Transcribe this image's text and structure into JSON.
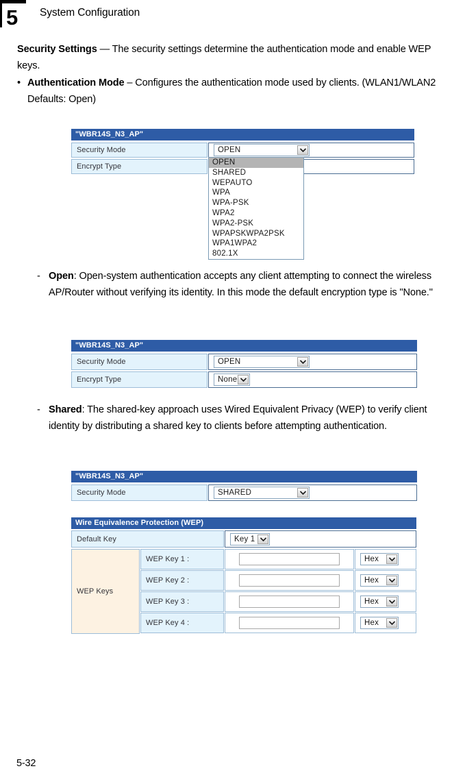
{
  "chapter": {
    "number": "5",
    "title": "System Configuration"
  },
  "footer": {
    "page_number": "5-32"
  },
  "intro": {
    "heading": "Security Settings",
    "text": " — The security settings determine the authentication mode and enable WEP keys."
  },
  "bullets": {
    "auth_mode": {
      "marker": "•",
      "heading": "Authentication Mode",
      "text": " – Configures the authentication mode used by clients. (WLAN1/WLAN2 Defaults: Open)"
    },
    "open": {
      "marker": "-",
      "heading": "Open",
      "text": ": Open-system authentication accepts any client attempting to connect the wireless AP/Router without verifying its identity. In this mode the default encryption type is \"None.\""
    },
    "shared": {
      "marker": "-",
      "heading": "Shared",
      "text": ": The shared-key approach uses Wired Equivalent Privacy (WEP) to verify client identity by distributing a shared key to clients before attempting authentication."
    }
  },
  "figure1": {
    "panel_title": "\"WBR14S_N3_AP\"",
    "rows": [
      {
        "label": "Security Mode",
        "value": "OPEN"
      },
      {
        "label": "Encrypt Type",
        "value": ""
      }
    ],
    "dropdown": {
      "selected": "OPEN",
      "options": [
        "OPEN",
        "SHARED",
        "WEPAUTO",
        "WPA",
        "WPA-PSK",
        "WPA2",
        "WPA2-PSK",
        "WPAPSKWPA2PSK",
        "WPA1WPA2",
        "802.1X"
      ]
    }
  },
  "figure2": {
    "panel_title": "\"WBR14S_N3_AP\"",
    "rows": [
      {
        "label": "Security Mode",
        "value": "OPEN"
      },
      {
        "label": "Encrypt Type",
        "value": "None"
      }
    ]
  },
  "figure3": {
    "panel_title": "\"WBR14S_N3_AP\"",
    "security_mode_label": "Security Mode",
    "security_mode_value": "SHARED",
    "wep": {
      "panel_title": "Wire Equivalence Protection (WEP)",
      "default_key_label": "Default Key",
      "default_key_value": "Key 1",
      "keys_label": "WEP Keys",
      "keys": [
        {
          "label": "WEP Key 1 :",
          "value": "",
          "format": "Hex"
        },
        {
          "label": "WEP Key 2 :",
          "value": "",
          "format": "Hex"
        },
        {
          "label": "WEP Key 3 :",
          "value": "",
          "format": "Hex"
        },
        {
          "label": "WEP Key 4 :",
          "value": "",
          "format": "Hex"
        }
      ]
    }
  },
  "colors": {
    "panel_header_blue": "#2e5ca6",
    "label_cell_blue": "#e3f3fc",
    "keys_cell_cream": "#fdf2e2",
    "dropdown_highlight": "#b4b4b4"
  }
}
